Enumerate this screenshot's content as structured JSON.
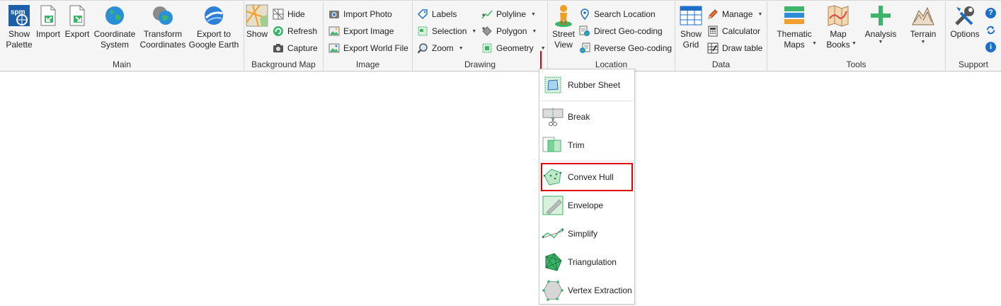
{
  "groups": {
    "main": {
      "label": "Main",
      "items": {
        "show_palette": [
          "Show",
          "Palette"
        ],
        "import": [
          "Import"
        ],
        "export": [
          "Export"
        ],
        "coordinate_system": [
          "Coordinate",
          "System"
        ],
        "transform_coordinates": [
          "Transform",
          "Coordinates"
        ],
        "export_google_earth": [
          "Export to",
          "Google Earth"
        ]
      }
    },
    "background_map": {
      "label": "Background Map",
      "show": "Show",
      "hide": "Hide",
      "refresh": "Refresh",
      "capture": "Capture"
    },
    "image": {
      "label": "Image",
      "import_photo": "Import Photo",
      "export_image": "Export Image",
      "export_world_file": "Export World File"
    },
    "drawing": {
      "label": "Drawing",
      "labels": "Labels",
      "selection": "Selection",
      "zoom": "Zoom",
      "polyline": "Polyline",
      "polygon": "Polygon",
      "geometry": "Geometry"
    },
    "location": {
      "label": "Location",
      "street_view": [
        "Street",
        "View"
      ],
      "search_location": "Search Location",
      "direct_geocoding": "Direct Geo-coding",
      "reverse_geocoding": "Reverse Geo-coding"
    },
    "data": {
      "label": "Data",
      "show_grid": [
        "Show",
        "Grid"
      ],
      "manage": "Manage",
      "calculator": "Calculator",
      "draw_table": "Draw table"
    },
    "tools": {
      "label": "Tools",
      "thematic_maps": [
        "Thematic",
        "Maps"
      ],
      "map_books": [
        "Map",
        "Books"
      ],
      "analysis": [
        "Analysis"
      ],
      "terrain": [
        "Terrain"
      ]
    },
    "support": {
      "label": "Support",
      "options": [
        "Options"
      ]
    }
  },
  "geometry_menu": {
    "items": [
      "Rubber Sheet",
      "Break",
      "Trim",
      "Convex Hull",
      "Envelope",
      "Simplify",
      "Triangulation",
      "Vertex Extraction"
    ],
    "highlighted": "Convex Hull"
  },
  "colors": {
    "ribbon_bg": "#f5f5f5",
    "highlight": "#e00000",
    "icon_green": "#3cb56a",
    "icon_blue": "#1e6fc8"
  }
}
